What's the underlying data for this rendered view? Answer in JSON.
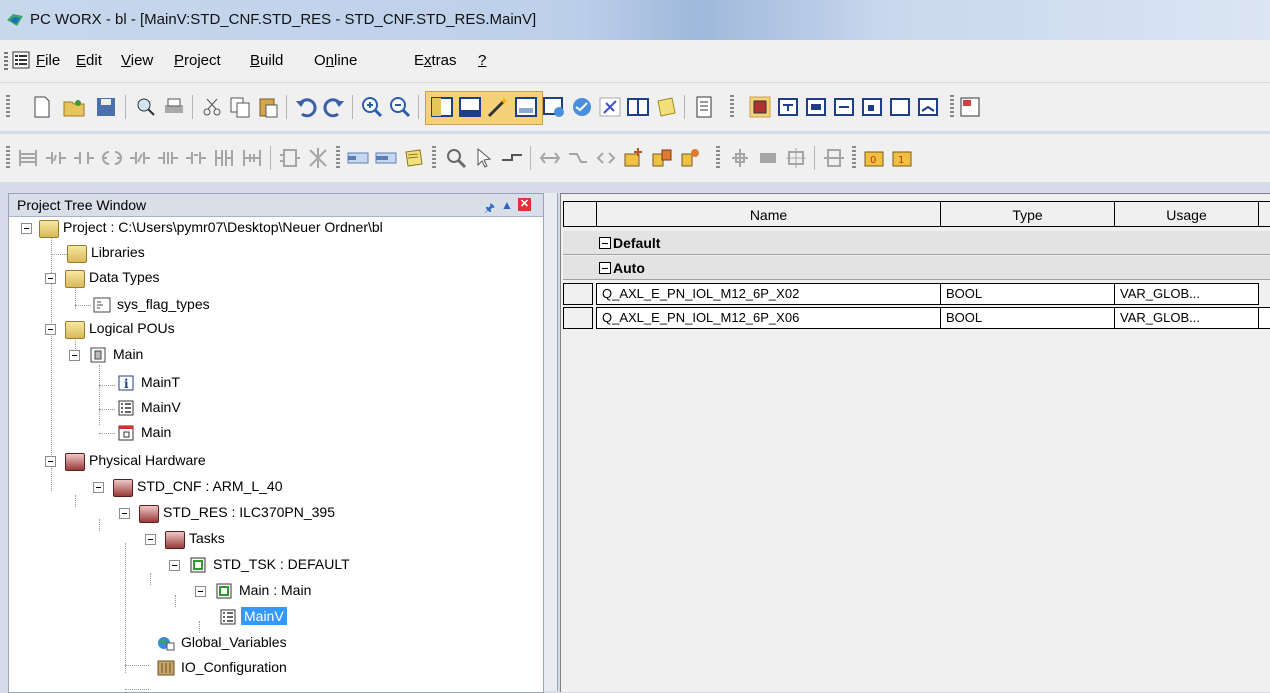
{
  "window": {
    "title": "PC WORX - bl - [MainV:STD_CNF.STD_RES - STD_CNF.STD_RES.MainV]"
  },
  "menu": {
    "items": [
      {
        "label": "File",
        "accel": "F"
      },
      {
        "label": "Edit",
        "accel": "E"
      },
      {
        "label": "View",
        "accel": "V"
      },
      {
        "label": "Project",
        "accel": "P"
      },
      {
        "label": "Build",
        "accel": "B"
      },
      {
        "label": "Online",
        "accel": "n"
      },
      {
        "label": "Extras",
        "accel": "x"
      },
      {
        "label": "?",
        "accel": "?"
      }
    ]
  },
  "project_tree": {
    "title": "Project Tree Window",
    "nodes": [
      {
        "label": "Project : C:\\Users\\pymr07\\Desktop\\Neuer Ordner\\bl",
        "icon": "project-folder-icon"
      },
      {
        "label": "Libraries",
        "icon": "folder-icon"
      },
      {
        "label": "Data Types",
        "icon": "folder-icon"
      },
      {
        "label": "sys_flag_types",
        "icon": "datatype-icon"
      },
      {
        "label": "Logical POUs",
        "icon": "folder-icon"
      },
      {
        "label": "Main",
        "icon": "pou-icon"
      },
      {
        "label": "MainT",
        "icon": "info-icon"
      },
      {
        "label": "MainV",
        "icon": "variables-icon"
      },
      {
        "label": "Main",
        "icon": "code-sheet-icon"
      },
      {
        "label": "Physical Hardware",
        "icon": "hardware-folder-icon"
      },
      {
        "label": "STD_CNF : ARM_L_40",
        "icon": "hardware-folder-icon"
      },
      {
        "label": "STD_RES : ILC370PN_395",
        "icon": "hardware-folder-icon"
      },
      {
        "label": "Tasks",
        "icon": "hardware-folder-icon"
      },
      {
        "label": "STD_TSK : DEFAULT",
        "icon": "task-icon"
      },
      {
        "label": "Main : Main",
        "icon": "task-icon"
      },
      {
        "label": "MainV",
        "icon": "variables-icon"
      },
      {
        "label": "Global_Variables",
        "icon": "globe-icon"
      },
      {
        "label": "IO_Configuration",
        "icon": "io-config-icon"
      }
    ]
  },
  "variables_grid": {
    "columns": [
      "Name",
      "Type",
      "Usage"
    ],
    "groups": [
      {
        "label": "Default"
      },
      {
        "label": "Auto"
      }
    ],
    "rows": [
      {
        "name": "Q_AXL_E_PN_IOL_M12_6P_X02",
        "type": "BOOL",
        "usage": "VAR_GLOB..."
      },
      {
        "name": "Q_AXL_E_PN_IOL_M12_6P_X06",
        "type": "BOOL",
        "usage": "VAR_GLOB..."
      }
    ]
  },
  "colors": {
    "selection": "#3399ff",
    "toolbar_bg": "#f0f0f0",
    "panel_border": "#9aa4b5"
  }
}
